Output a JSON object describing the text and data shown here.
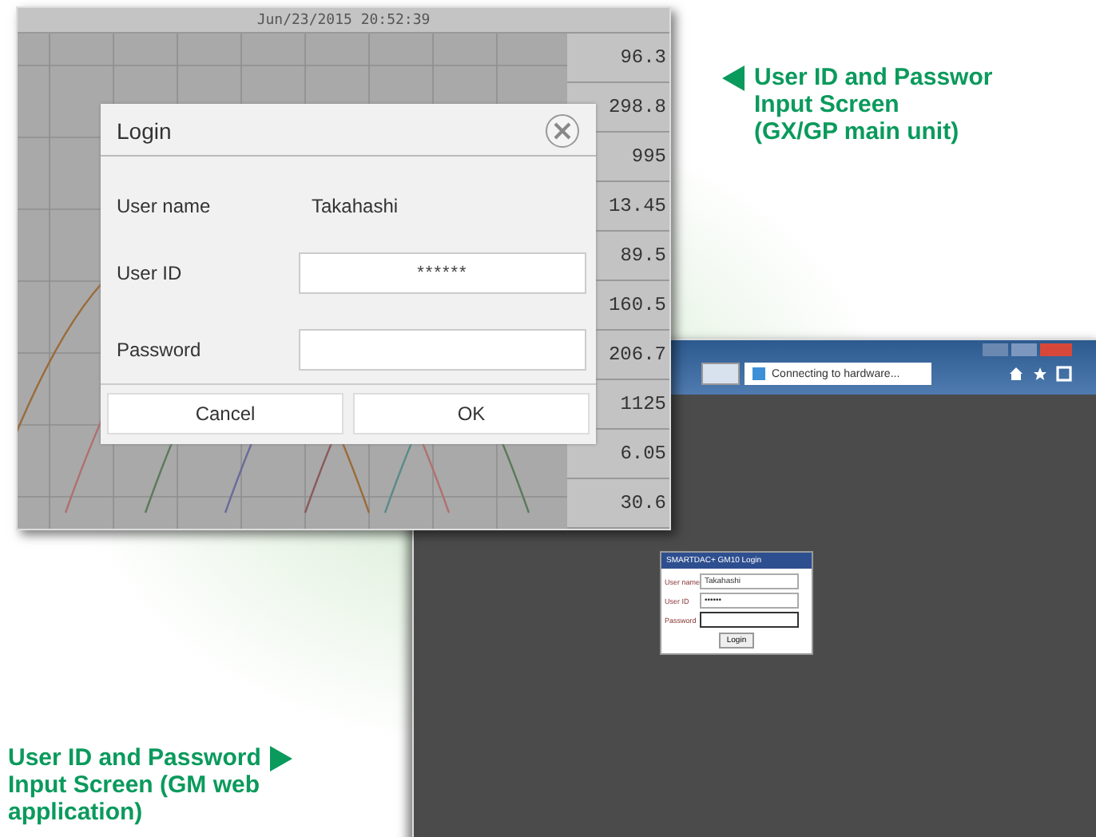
{
  "main_unit": {
    "datetime": "Jun/23/2015 20:52:39",
    "readings": [
      "96.3",
      "298.8",
      "995",
      "13.45",
      "89.5",
      "160.5",
      "206.7",
      "1125",
      "6.05",
      "30.6"
    ],
    "dialog": {
      "title": "Login",
      "user_name_label": "User name",
      "user_name": "Takahashi",
      "fields": [
        {
          "label": "User ID",
          "value": "******"
        },
        {
          "label": "Password"
        }
      ],
      "buttons": [
        "Cancel",
        "OK"
      ]
    }
  },
  "caption_main": {
    "lines": [
      "User ID and Passwor",
      "Input Screen",
      "(GX/GP main unit)"
    ]
  },
  "web_app": {
    "tab_title": "Connecting to hardware...",
    "login": {
      "title": "SMARTDAC+ GM10 Login",
      "user_name_label": "User name",
      "user_name": "Takahashi",
      "fields": [
        {
          "label": "User ID",
          "value": "••••••"
        },
        {
          "label": "Password"
        }
      ],
      "button": "Login"
    }
  },
  "caption_web": {
    "lines": [
      "User ID and Password",
      "Input Screen (GM web",
      "application)"
    ]
  }
}
